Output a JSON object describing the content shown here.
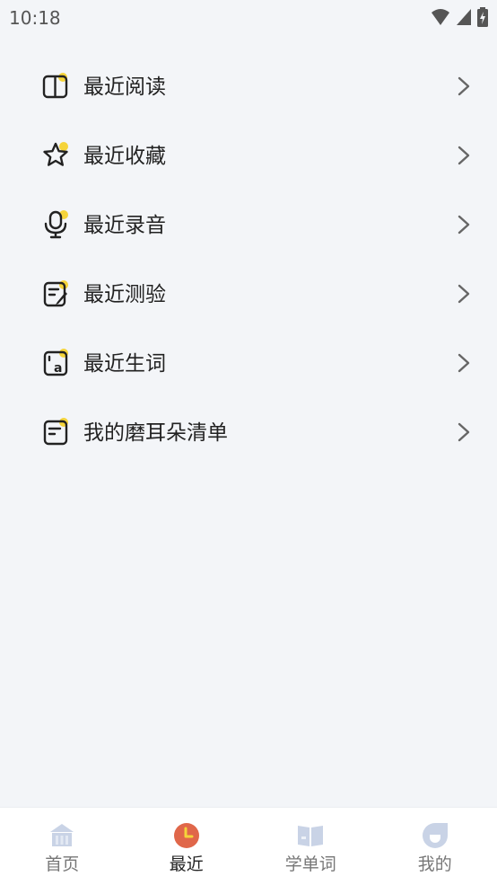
{
  "status_bar": {
    "time": "10:18"
  },
  "menu": [
    {
      "label": "最近阅读",
      "icon": "book-icon"
    },
    {
      "label": "最近收藏",
      "icon": "star-icon"
    },
    {
      "label": "最近录音",
      "icon": "microphone-icon"
    },
    {
      "label": "最近测验",
      "icon": "quiz-edit-icon"
    },
    {
      "label": "最近生词",
      "icon": "vocabulary-card-icon"
    },
    {
      "label": "我的磨耳朵清单",
      "icon": "playlist-icon"
    }
  ],
  "tabs": [
    {
      "label": "首页",
      "icon": "home-icon",
      "active": false
    },
    {
      "label": "最近",
      "icon": "clock-icon",
      "active": true
    },
    {
      "label": "学单词",
      "icon": "open-book-icon",
      "active": false
    },
    {
      "label": "我的",
      "icon": "profile-icon",
      "active": false
    }
  ],
  "colors": {
    "accent_yellow": "#f5d43a",
    "active_tab": "#e0674a",
    "inactive_tab_icon": "#c9d3e6",
    "background": "#f3f5f8"
  }
}
